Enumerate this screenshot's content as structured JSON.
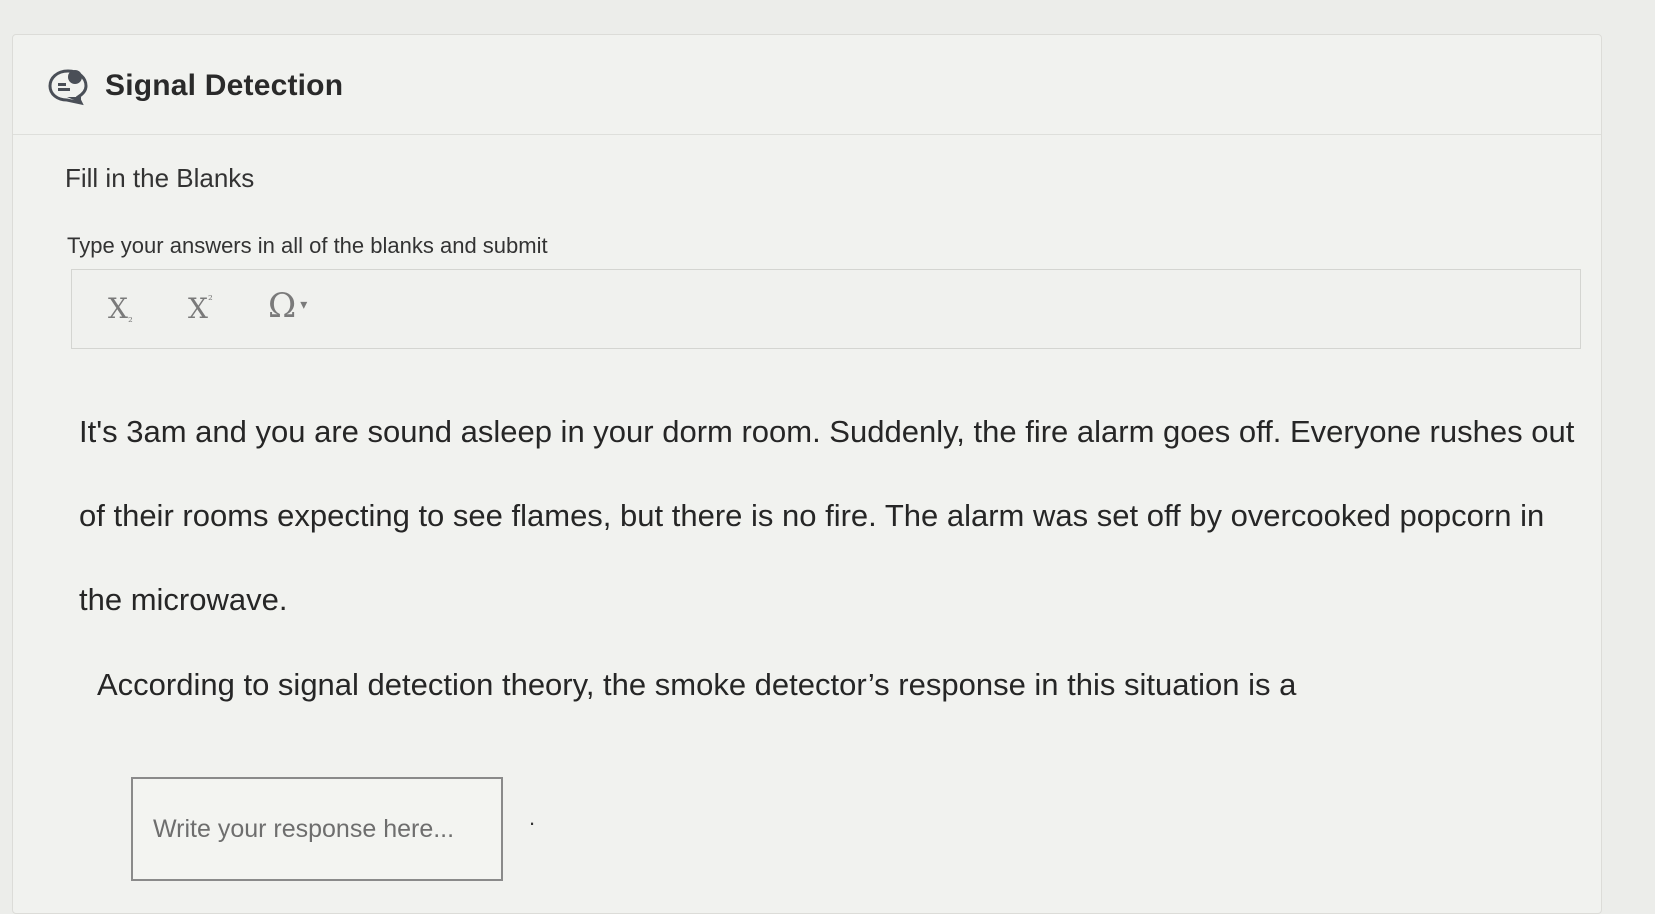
{
  "card": {
    "title": "Signal Detection",
    "icon": "chat-bubble-icon"
  },
  "section": {
    "title": "Fill in the Blanks",
    "instruction": "Type your answers in all of the blanks and submit"
  },
  "toolbar": {
    "subscript": {
      "icon": "subscript-icon",
      "glyph": "X",
      "mark": "₂"
    },
    "superscript": {
      "icon": "superscript-icon",
      "glyph": "X",
      "mark": "²"
    },
    "special_chars": {
      "icon": "omega-icon",
      "glyph": "Ω",
      "caret": "▾"
    }
  },
  "passage": {
    "line1": "It's 3am and you are sound asleep in your dorm room.  Suddenly, the fire alarm goes off.  Everyone rushes out",
    "line2": "of their rooms expecting to see flames, but there is no fire.  The alarm was set off by overcooked popcorn in",
    "line3": "the microwave."
  },
  "question": {
    "text": "According to signal detection theory, the smoke detector’s response in this situation is a",
    "input_value": "",
    "input_placeholder": "Write your response here...",
    "trailing": "."
  },
  "colors": {
    "background": "#ecedea",
    "card": "#f1f2ef",
    "icon_accent": "#4a4f57"
  }
}
